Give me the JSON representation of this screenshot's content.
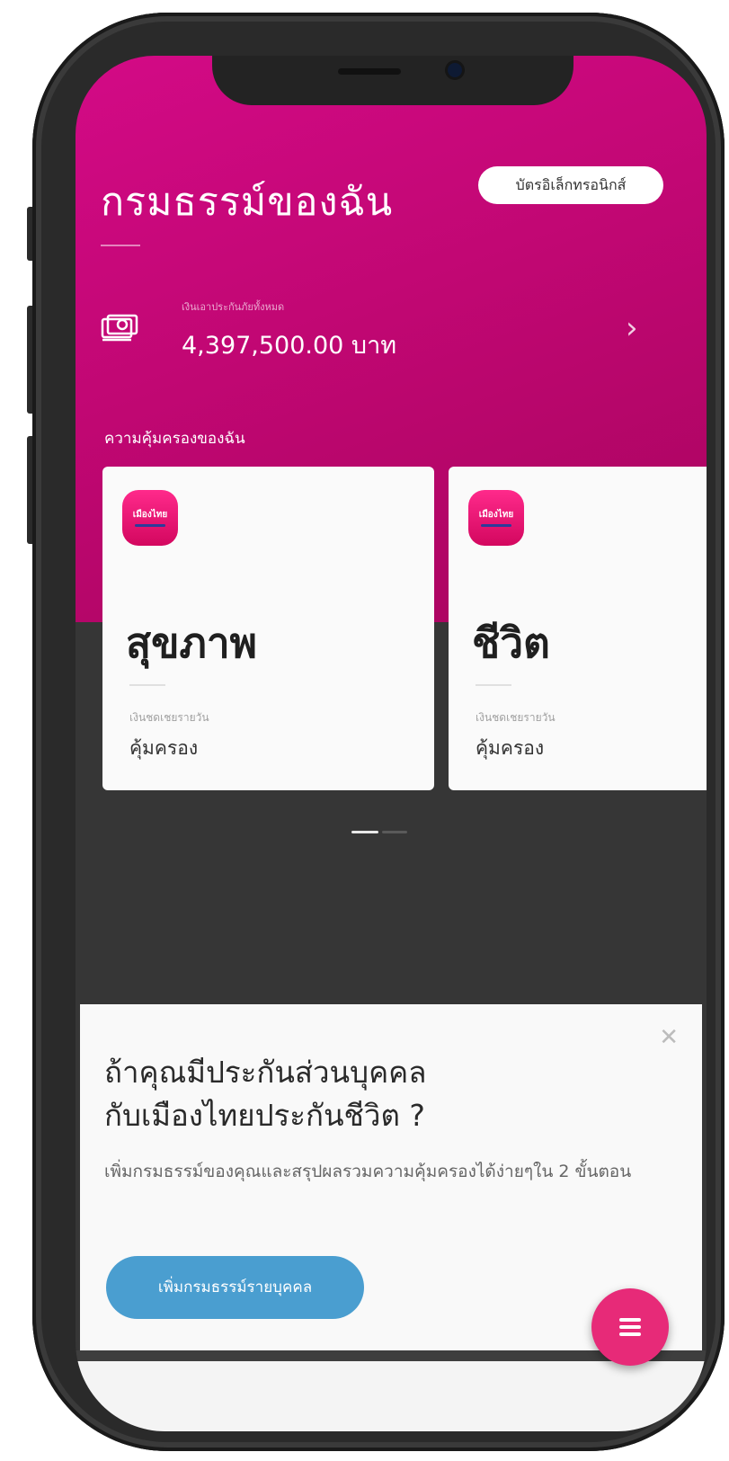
{
  "header": {
    "title": "กรมธรรม์ของฉัน",
    "ecard_button": "บัตรอิเล็กทรอนิกส์"
  },
  "summary": {
    "label": "เงินเอาประกันภัยทั้งหมด",
    "amount": "4,397,500.00 บาท",
    "icon": "money-stack-icon"
  },
  "coverage": {
    "section_title": "ความคุ้มครองของฉัน",
    "cards": [
      {
        "logo_text": "เมืองไทย",
        "name": "สุขภาพ",
        "sub_label": "เงินชดเชยรายวัน",
        "status": "คุ้มครอง"
      },
      {
        "logo_text": "เมืองไทย",
        "name": "ชีวิต",
        "sub_label": "เงินชดเชยรายวัน",
        "status": "คุ้มครอง"
      }
    ],
    "page_indicator": {
      "active": 0,
      "count": 2
    }
  },
  "promo": {
    "title_line1": "ถ้าคุณมีประกันส่วนบุคคล",
    "title_line2": "กับเมืองไทยประกันชีวิต ?",
    "description": "เพิ่มกรมธรรม์ของคุณและสรุปผลรวมความคุ้มครองได้ง่ายๆใน 2 ขั้นตอน",
    "button_label": "เพิ่มกรมธรรม์รายบุคคล",
    "close_icon": "close-icon"
  },
  "fab": {
    "icon": "menu-icon"
  },
  "colors": {
    "brand_pink": "#c10773",
    "button_blue": "#4a9ed0",
    "fab_pink": "#e72a78"
  }
}
